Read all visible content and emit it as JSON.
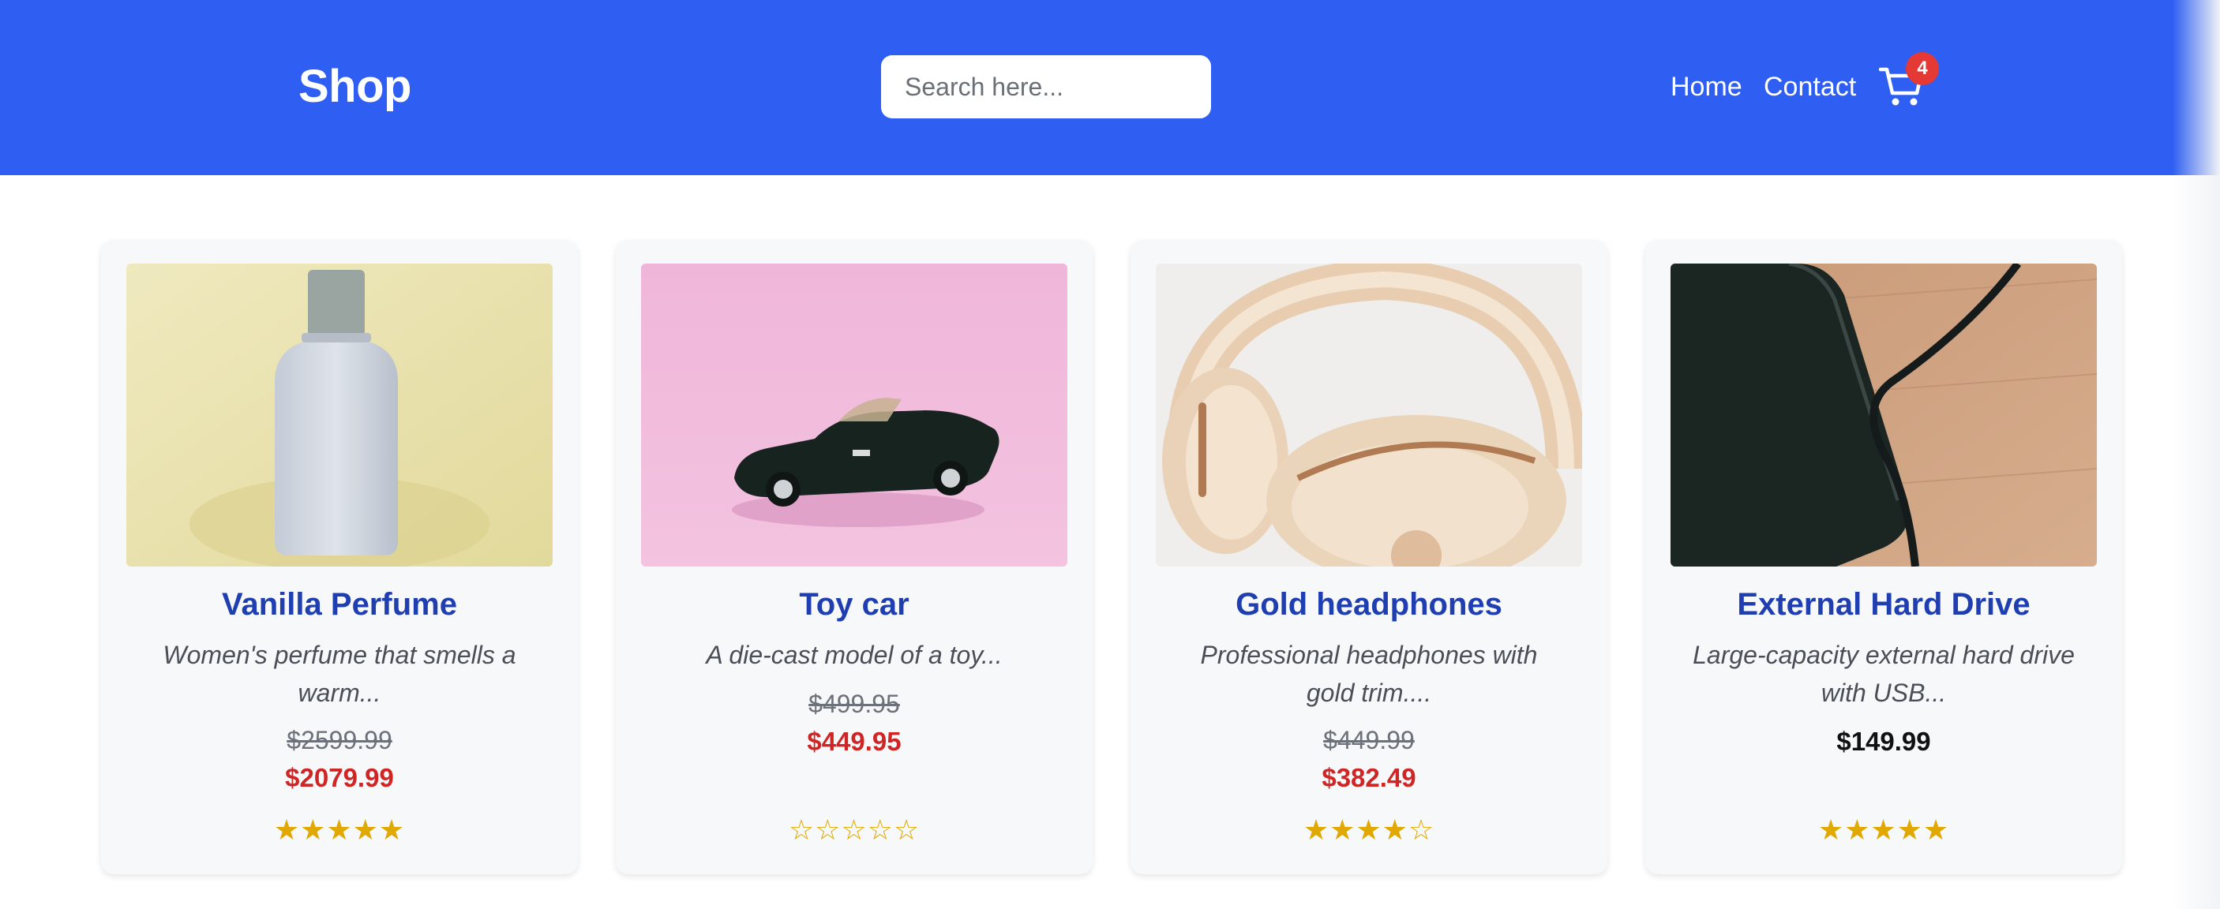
{
  "header": {
    "brand": "Shop",
    "search_placeholder": "Search here...",
    "nav": {
      "home": "Home",
      "contact": "Contact"
    },
    "cart_count": "4",
    "cart_icon": "shopping-cart-icon"
  },
  "colors": {
    "header_bg": "#2f5ff2",
    "title": "#1f3eb0",
    "sale_price": "#d02525",
    "star": "#e0a800",
    "badge": "#e53935"
  },
  "products": [
    {
      "title": "Vanilla Perfume",
      "description": "Women's perfume that smells a warm...",
      "old_price": "$2599.99",
      "price": "$2079.99",
      "rating": 5,
      "stars": "★★★★★"
    },
    {
      "title": "Toy car",
      "description": "A die-cast model of a toy...",
      "old_price": "$499.95",
      "price": "$449.95",
      "rating": 0,
      "stars": "☆☆☆☆☆"
    },
    {
      "title": "Gold headphones",
      "description": "Professional headphones with gold trim....",
      "old_price": "$449.99",
      "price": "$382.49",
      "rating": 4,
      "stars": "★★★★☆"
    },
    {
      "title": "External Hard Drive",
      "description": "Large-capacity external hard drive with USB...",
      "price": "$149.99",
      "rating": 5,
      "stars": "★★★★★"
    }
  ]
}
